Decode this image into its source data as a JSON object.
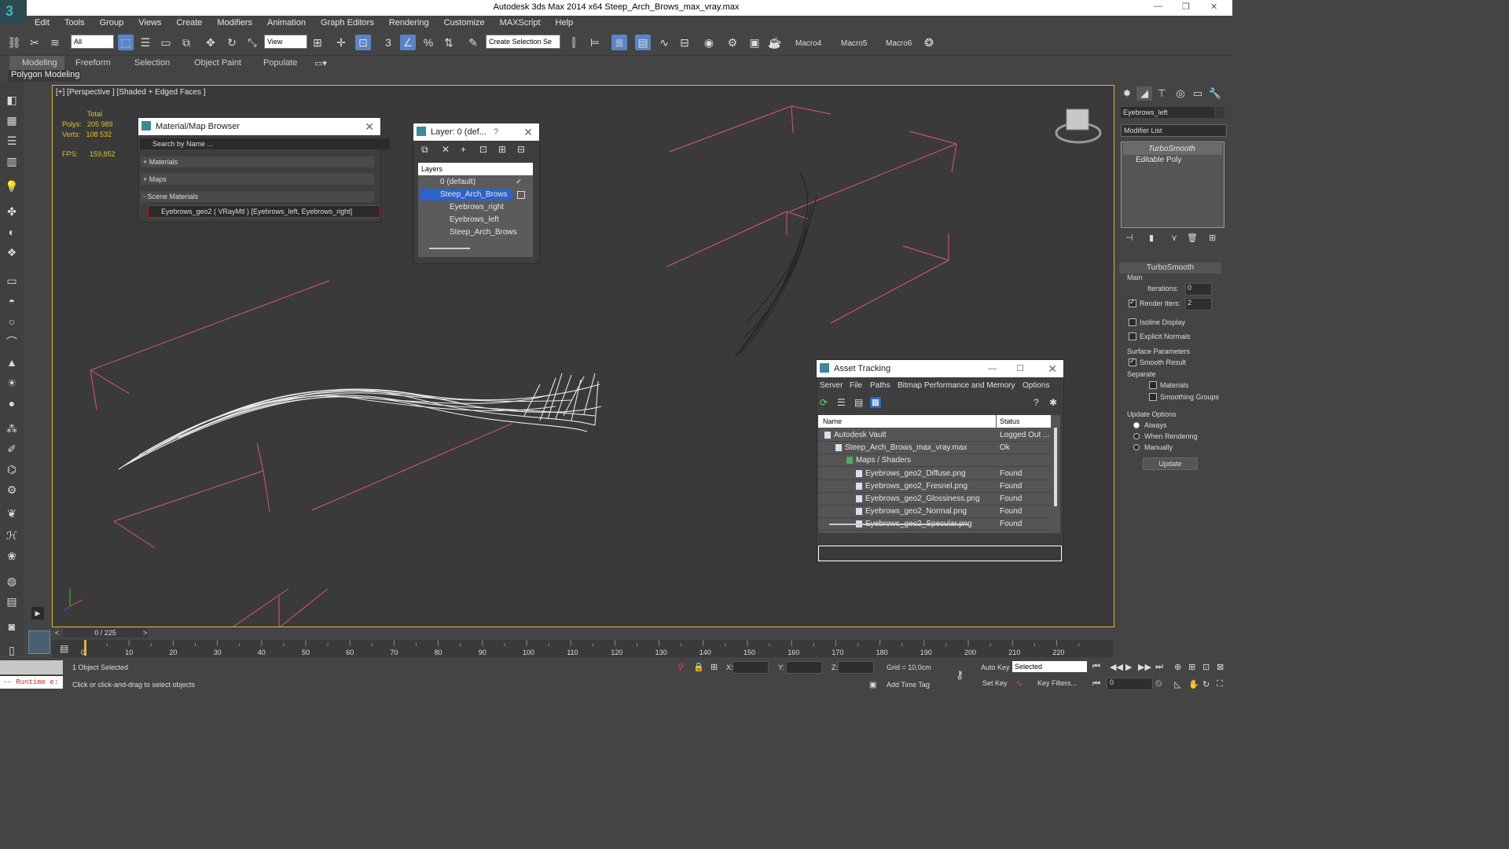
{
  "window": {
    "title": "Autodesk 3ds Max  2014 x64     Steep_Arch_Brows_max_vray.max"
  },
  "menu": [
    "Edit",
    "Tools",
    "Group",
    "Views",
    "Create",
    "Modifiers",
    "Animation",
    "Graph Editors",
    "Rendering",
    "Customize",
    "MAXScript",
    "Help"
  ],
  "toolbar": {
    "filter": "All",
    "refcoord": "View",
    "selection_set": "Create Selection Se",
    "macros": [
      "Macro4",
      "Macro5",
      "Macro6"
    ]
  },
  "ribbon": {
    "tabs": [
      "Modeling",
      "Freeform",
      "Selection",
      "Object Paint",
      "Populate"
    ],
    "sub": "Polygon Modeling"
  },
  "viewport": {
    "label": "[+] [Perspective ] [Shaded + Edged Faces ]",
    "stats": {
      "total": "Total",
      "polys_label": "Polys:",
      "polys": "205 989",
      "verts_label": "Verts:",
      "verts": "108 532",
      "fps_label": "FPS:",
      "fps": "159,852"
    }
  },
  "material_browser": {
    "title": "Material/Map Browser",
    "search": "Search by Name ...",
    "materials": "+ Materials",
    "maps": "+ Maps",
    "scene": "- Scene Materials",
    "item": "Eyebrows_geo2 ( VRayMtl ) [Eyebrows_left, Eyebrows_right]"
  },
  "layer_dialog": {
    "title": "Layer: 0 (def...",
    "help": "?",
    "header": "Layers",
    "rows": [
      "0 (default)",
      "Steep_Arch_Brows",
      "Eyebrows_right",
      "Eyebrows_left",
      "Steep_Arch_Brows"
    ]
  },
  "asset_tracking": {
    "title": "Asset Tracking",
    "menu": [
      "Server",
      "File",
      "Paths",
      "Bitmap Performance and Memory",
      "Options"
    ],
    "cols": [
      "Name",
      "Status"
    ],
    "rows": [
      {
        "name": "Autodesk Vault",
        "status": "Logged Out ..."
      },
      {
        "name": "Steep_Arch_Brows_max_vray.max",
        "status": "Ok"
      },
      {
        "name": "Maps / Shaders",
        "status": ""
      },
      {
        "name": "Eyebrows_geo2_Diffuse.png",
        "status": "Found"
      },
      {
        "name": "Eyebrows_geo2_Fresnel.png",
        "status": "Found"
      },
      {
        "name": "Eyebrows_geo2_Glossiness.png",
        "status": "Found"
      },
      {
        "name": "Eyebrows_geo2_Normal.png",
        "status": "Found"
      },
      {
        "name": "Eyebrows_geo2_Specular.png",
        "status": "Found"
      }
    ]
  },
  "command_panel": {
    "object_name": "Eyebrows_left",
    "modifier_list": "Modifier List",
    "stack": [
      "TurboSmooth",
      "Editable Poly"
    ],
    "rollout": "TurboSmooth",
    "main": "Main",
    "iterations_label": "Iterations:",
    "iterations": "0",
    "render_iters_label": "Render Iters:",
    "render_iters": "2",
    "isoline": "Isoline Display",
    "explicit": "Explicit Normals",
    "surface": "Surface Parameters",
    "smooth": "Smooth Result",
    "separate": "Separate",
    "materials": "Materials",
    "smoothing": "Smoothing Groups",
    "update_options": "Update Options",
    "always": "Always",
    "when_rendering": "When Rendering",
    "manually": "Manually",
    "update": "Update"
  },
  "timeline": {
    "frame": "0 / 225",
    "ticks": [
      "0",
      "10",
      "20",
      "30",
      "40",
      "50",
      "60",
      "70",
      "80",
      "90",
      "100",
      "110",
      "120",
      "130",
      "140",
      "150",
      "160",
      "170",
      "180",
      "190",
      "200",
      "210",
      "220"
    ]
  },
  "status": {
    "runtime": "-- Runtime e:",
    "selected": "1 Object Selected",
    "prompt": "Click or click-and-drag to select objects",
    "x": "X:",
    "y": "Y:",
    "z": "Z:",
    "grid": "Grid = 10,0cm",
    "add_time_tag": "Add Time Tag",
    "auto_key": "Auto Key",
    "set_key": "Set Key",
    "key_mode": "Selected",
    "key_filters": "Key Filters...",
    "frame_field": "0"
  },
  "colors": {
    "accent": "#5a84c5",
    "bbox": "#e0508a",
    "viewport_border": "#d9b640",
    "stats": "#e0c12f"
  }
}
